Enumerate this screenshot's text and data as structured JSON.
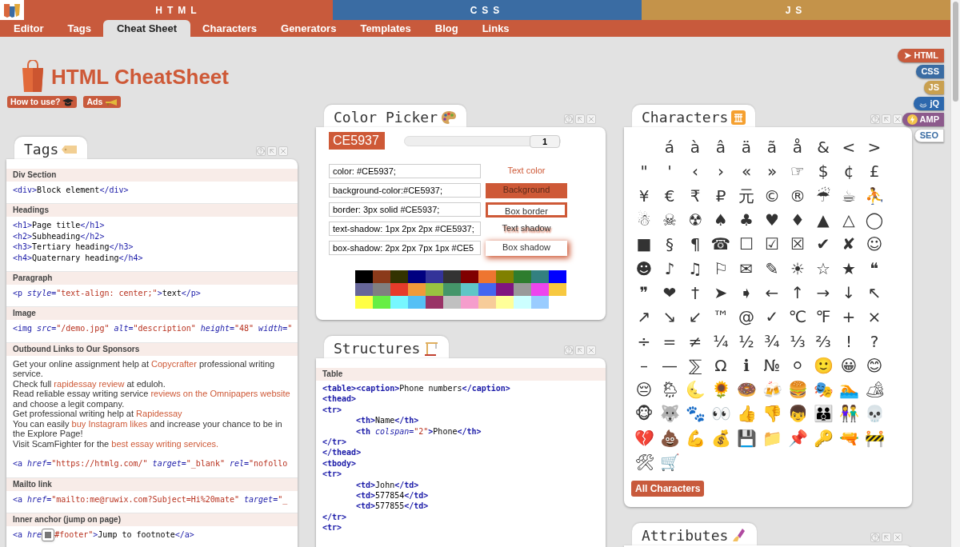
{
  "top_bands": [
    {
      "label": "HTML",
      "color": "#c85a3c"
    },
    {
      "label": "CSS",
      "color": "#3a6ca3"
    },
    {
      "label": "JS",
      "color": "#c4934a"
    }
  ],
  "nav": [
    {
      "label": "Editor",
      "selected": false
    },
    {
      "label": "Tags",
      "selected": false
    },
    {
      "label": "Cheat Sheet",
      "selected": true
    },
    {
      "label": "Characters",
      "selected": false
    },
    {
      "label": "Generators",
      "selected": false
    },
    {
      "label": "Templates",
      "selected": false
    },
    {
      "label": "Blog",
      "selected": false
    },
    {
      "label": "Links",
      "selected": false
    }
  ],
  "page_title": "HTML CheatSheet",
  "header_buttons": [
    {
      "label": "How to use?",
      "kind": "cap"
    },
    {
      "label": "Ads",
      "kind": "horn"
    }
  ],
  "language_tabs": [
    {
      "label": "HTML",
      "marker": "➤",
      "kind": "plain",
      "color": "#c85a3c",
      "selected": true
    },
    {
      "label": "CSS",
      "kind": "plain",
      "color": "#3a6ca3",
      "selected": false
    },
    {
      "label": "JS",
      "kind": "plain",
      "color": "#c9a050",
      "selected": false
    },
    {
      "label": "jQ",
      "kind": "swirl",
      "color": "#2d68ad",
      "selected": false
    },
    {
      "label": "AMP",
      "kind": "bolt",
      "color": "#8c5a8c",
      "selected": false
    },
    {
      "label": "SEO",
      "kind": "plain",
      "color": "#ffffff",
      "selected": false
    }
  ],
  "tags_panel": {
    "title": "Tags",
    "sections": [
      {
        "heading": "Div Section",
        "items": [
          {
            "kind": "code",
            "tokens": [
              {
                "kind": "tag",
                "text": "<div>"
              },
              {
                "kind": "text",
                "text": "Block element"
              },
              {
                "kind": "tag",
                "text": "</div>"
              }
            ]
          }
        ]
      },
      {
        "heading": "Headings",
        "items": [
          {
            "kind": "code",
            "tokens": [
              {
                "kind": "tag",
                "text": "<h1>"
              },
              {
                "kind": "text",
                "text": "Page title"
              },
              {
                "kind": "tag",
                "text": "</h1>"
              }
            ]
          },
          {
            "kind": "code",
            "tokens": [
              {
                "kind": "tag",
                "text": "<h2>"
              },
              {
                "kind": "text",
                "text": "Subheading"
              },
              {
                "kind": "tag",
                "text": "</h2>"
              }
            ]
          },
          {
            "kind": "code",
            "tokens": [
              {
                "kind": "tag",
                "text": "<h3>"
              },
              {
                "kind": "text",
                "text": "Tertiary heading"
              },
              {
                "kind": "tag",
                "text": "</h3>"
              }
            ]
          },
          {
            "kind": "code",
            "tokens": [
              {
                "kind": "tag",
                "text": "<h4>"
              },
              {
                "kind": "text",
                "text": "Quaternary heading"
              },
              {
                "kind": "tag",
                "text": "</h4>"
              }
            ]
          }
        ]
      },
      {
        "heading": "Paragraph",
        "items": [
          {
            "kind": "code",
            "tokens": [
              {
                "kind": "tag",
                "text": "<p"
              },
              {
                "kind": "attr",
                "text": " style="
              },
              {
                "kind": "value",
                "text": "\"text-align: center;\""
              },
              {
                "kind": "tag",
                "text": ">"
              },
              {
                "kind": "text",
                "text": "text"
              },
              {
                "kind": "tag",
                "text": "</p>"
              }
            ]
          }
        ]
      },
      {
        "heading": "Image",
        "items": [
          {
            "kind": "code",
            "tokens": [
              {
                "kind": "tag",
                "text": "<img"
              },
              {
                "kind": "attr",
                "text": " src="
              },
              {
                "kind": "value",
                "text": "\"/demo.jpg\""
              },
              {
                "kind": "attr",
                "text": " alt="
              },
              {
                "kind": "value",
                "text": "\"description\""
              },
              {
                "kind": "attr",
                "text": " height="
              },
              {
                "kind": "value",
                "text": "\"48\""
              },
              {
                "kind": "attr",
                "text": " width="
              },
              {
                "kind": "value",
                "text": "\""
              }
            ]
          }
        ]
      },
      {
        "heading": "Outbound Links to Our Sponsors",
        "items": [
          {
            "kind": "prose",
            "tokens": [
              {
                "kind": "plain",
                "text": "Get your online assignment help at "
              },
              {
                "kind": "link",
                "text": "Copycrafter"
              },
              {
                "kind": "plain",
                "text": " professional writing service."
              }
            ]
          },
          {
            "kind": "prose",
            "tokens": [
              {
                "kind": "plain",
                "text": "Check full "
              },
              {
                "kind": "link",
                "text": "rapidessay review"
              },
              {
                "kind": "plain",
                "text": " at eduloh."
              }
            ]
          },
          {
            "kind": "prose",
            "tokens": [
              {
                "kind": "plain",
                "text": "Read reliable essay writing service "
              },
              {
                "kind": "link",
                "text": "reviews on the Omnipapers website"
              },
              {
                "kind": "plain",
                "text": " and choose a legit company."
              }
            ]
          },
          {
            "kind": "prose",
            "tokens": [
              {
                "kind": "plain",
                "text": "Get professional writing help at "
              },
              {
                "kind": "link",
                "text": "Rapidessay"
              }
            ]
          },
          {
            "kind": "prose",
            "tokens": [
              {
                "kind": "plain",
                "text": "You can easily "
              },
              {
                "kind": "link",
                "text": "buy Instagram likes"
              },
              {
                "kind": "plain",
                "text": " and increase your chance to be in the Explore Page!"
              }
            ]
          },
          {
            "kind": "prose",
            "tokens": [
              {
                "kind": "plain",
                "text": "Visit ScamFighter for the "
              },
              {
                "kind": "link",
                "text": "best essay writing services."
              }
            ]
          },
          {
            "kind": "code",
            "tokens": [
              {
                "kind": "tag",
                "text": "<a"
              },
              {
                "kind": "attr",
                "text": " href="
              },
              {
                "kind": "value",
                "text": "\"https://htmlg.com/\""
              },
              {
                "kind": "attr",
                "text": " target="
              },
              {
                "kind": "value",
                "text": "\"_blank\""
              },
              {
                "kind": "attr",
                "text": " rel="
              },
              {
                "kind": "value",
                "text": "\"nofollo"
              }
            ]
          }
        ]
      },
      {
        "heading": "Mailto link",
        "items": [
          {
            "kind": "code",
            "tokens": [
              {
                "kind": "tag",
                "text": "<a"
              },
              {
                "kind": "attr",
                "text": " href="
              },
              {
                "kind": "value",
                "text": "\"mailto:me@ruwix.com?Subject=Hi%20mate\""
              },
              {
                "kind": "attr",
                "text": " target="
              },
              {
                "kind": "value",
                "text": "\"_"
              }
            ]
          }
        ]
      },
      {
        "heading": "Inner anchor (jump on page)",
        "items": [
          {
            "kind": "code",
            "tokens": [
              {
                "kind": "tag",
                "text": "<a"
              },
              {
                "kind": "attr",
                "text": " hre"
              },
              {
                "kind": "covered"
              },
              {
                "kind": "value",
                "text": "#footer\""
              },
              {
                "kind": "tag",
                "text": ">"
              },
              {
                "kind": "text",
                "text": "Jump to footnote"
              },
              {
                "kind": "tag",
                "text": "</a>"
              }
            ]
          }
        ]
      }
    ]
  },
  "color_picker": {
    "title": "Color Picker",
    "hex": "CE5937",
    "slider": {
      "level": 1,
      "reading": "1"
    },
    "rules": [
      {
        "kind": "text-color",
        "value": "color: #CE5937;",
        "sample": "Text color"
      },
      {
        "kind": "background",
        "value": "background-color:#CE5937;",
        "sample": "Background"
      },
      {
        "kind": "border",
        "value": "border: 3px solid #CE5937;",
        "sample": "Box border"
      },
      {
        "kind": "text-shadow",
        "value": "text-shadow: 1px 2px 2px #CE5937;",
        "sample": "Text shadow"
      },
      {
        "kind": "box-shadow",
        "value": "box-shadow: 2px 2px 7px 1px #CE5",
        "sample": "Box shadow"
      }
    ],
    "palette": [
      {
        "color": "#000000"
      },
      {
        "color": "#8b3a1a"
      },
      {
        "color": "#333300"
      },
      {
        "color": "#000080"
      },
      {
        "color": "#333399"
      },
      {
        "color": "#333333"
      },
      {
        "color": "#800000"
      },
      {
        "color": "#ee7530"
      },
      {
        "color": "#808000"
      },
      {
        "color": "#2e7d2e"
      },
      {
        "color": "#338080"
      },
      {
        "color": "#0000ff"
      },
      {
        "color": "#666699"
      },
      {
        "color": "#808080"
      },
      {
        "color": "#e63b2a"
      },
      {
        "color": "#f09a3a"
      },
      {
        "color": "#99c340"
      },
      {
        "color": "#44966a"
      },
      {
        "color": "#5fc6c6"
      },
      {
        "color": "#4466f0"
      },
      {
        "color": "#801580"
      },
      {
        "color": "#999999"
      },
      {
        "color": "#ee44ee"
      },
      {
        "color": "#f7c840"
      },
      {
        "color": "#ffff44"
      },
      {
        "color": "#66ee44"
      },
      {
        "color": "#77f7ff"
      },
      {
        "color": "#55c0f5"
      },
      {
        "color": "#993366"
      },
      {
        "color": "#c0c0c0"
      },
      {
        "color": "#f59dcc"
      },
      {
        "color": "#f7cc99"
      },
      {
        "color": "#ffff99"
      },
      {
        "color": "#ccffff"
      },
      {
        "color": "#99ccff"
      }
    ]
  },
  "structures_panel": {
    "title": "Structures",
    "sections": [
      {
        "heading": "Table",
        "lines": [
          {
            "indented": false,
            "tokens": [
              {
                "kind": "tag",
                "text": "<table><caption>"
              },
              {
                "kind": "text",
                "text": "Phone numbers"
              },
              {
                "kind": "tag",
                "text": "</caption>"
              }
            ]
          },
          {
            "indented": false,
            "tokens": [
              {
                "kind": "tag",
                "text": "<thead>"
              }
            ]
          },
          {
            "indented": false,
            "tokens": [
              {
                "kind": "tag",
                "text": "<tr>"
              }
            ]
          },
          {
            "indented": true,
            "tokens": [
              {
                "kind": "tag",
                "text": "<th>"
              },
              {
                "kind": "text",
                "text": "Name"
              },
              {
                "kind": "tag",
                "text": "</th>"
              }
            ]
          },
          {
            "indented": true,
            "tokens": [
              {
                "kind": "tag",
                "text": "<th"
              },
              {
                "kind": "attr",
                "text": " colspan="
              },
              {
                "kind": "value",
                "text": "\"2\""
              },
              {
                "kind": "tag",
                "text": ">"
              },
              {
                "kind": "text",
                "text": "Phone"
              },
              {
                "kind": "tag",
                "text": "</th>"
              }
            ]
          },
          {
            "indented": false,
            "tokens": [
              {
                "kind": "tag",
                "text": "</tr>"
              }
            ]
          },
          {
            "indented": false,
            "tokens": [
              {
                "kind": "tag",
                "text": "</thead>"
              }
            ]
          },
          {
            "indented": false,
            "tokens": [
              {
                "kind": "tag",
                "text": "<tbody>"
              }
            ]
          },
          {
            "indented": false,
            "tokens": [
              {
                "kind": "tag",
                "text": "<tr>"
              }
            ]
          },
          {
            "indented": true,
            "tokens": [
              {
                "kind": "tag",
                "text": "<td>"
              },
              {
                "kind": "text",
                "text": "John"
              },
              {
                "kind": "tag",
                "text": "</td>"
              }
            ]
          },
          {
            "indented": true,
            "tokens": [
              {
                "kind": "tag",
                "text": "<td>"
              },
              {
                "kind": "text",
                "text": "577854"
              },
              {
                "kind": "tag",
                "text": "</td>"
              }
            ]
          },
          {
            "indented": true,
            "tokens": [
              {
                "kind": "tag",
                "text": "<td>"
              },
              {
                "kind": "text",
                "text": "577855"
              },
              {
                "kind": "tag",
                "text": "</td>"
              }
            ]
          },
          {
            "indented": false,
            "tokens": [
              {
                "kind": "tag",
                "text": "</tr>"
              }
            ]
          },
          {
            "indented": false,
            "tokens": [
              {
                "kind": "tag",
                "text": "<tr>"
              }
            ]
          }
        ]
      }
    ]
  },
  "characters_panel": {
    "title": "Characters",
    "chars": [
      "á",
      "à",
      "â",
      "ä",
      "ã",
      "å",
      "&",
      "<",
      ">",
      "\"",
      "'",
      "‹",
      "›",
      "«",
      "»",
      "☞",
      "$",
      "¢",
      "£",
      "¥",
      "€",
      "₹",
      "₽",
      "元",
      "©",
      "®",
      "☔",
      "☕",
      "⛹",
      "☃",
      "☠",
      "☢",
      "♠",
      "♣",
      "♥",
      "♦",
      "▲",
      "△",
      "◯",
      "■",
      "§",
      "¶",
      "☎",
      "☐",
      "☑",
      "☒",
      "✔",
      "✘",
      "☺",
      "☻",
      "♪",
      "♫",
      "⚐",
      "✉",
      "✎",
      "☀",
      "☆",
      "★",
      "❝",
      "❞",
      "❤",
      "†",
      "➤",
      "➧",
      "←",
      "↑",
      "→",
      "↓",
      "↖",
      "↗",
      "↘",
      "↙",
      "™",
      "@",
      "✓",
      "℃",
      "℉",
      "+",
      "×",
      "÷",
      "=",
      "≠",
      "¼",
      "½",
      "¾",
      "⅓",
      "⅔",
      "!",
      "?",
      "–",
      "—",
      "⅀",
      "Ω",
      "ℹ",
      "№",
      "⚪",
      "🙂",
      "😀",
      "😊",
      "😔",
      "🌦",
      "🌜",
      "🌻",
      "🍩",
      "🍻",
      "🍔",
      "🎭",
      "🏊",
      "🏕",
      "🐵",
      "🐺",
      "🐾",
      "👀",
      "👍",
      "👎",
      "👦",
      "👪",
      "👫",
      "💀",
      "💔",
      "💩",
      "💪",
      "💰",
      "💾",
      "📁",
      "📌",
      "🔑",
      "🔫",
      "🚧",
      "🛠",
      "🛒"
    ],
    "button": "All Characters"
  },
  "attributes_panel": {
    "title": "Attributes"
  }
}
